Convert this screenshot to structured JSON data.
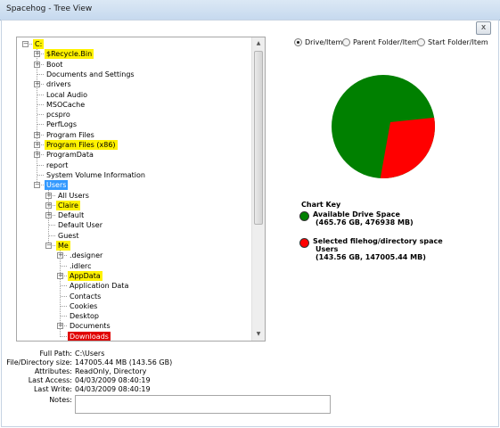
{
  "window": {
    "title": "Spacehog - Tree View",
    "close_glyph": "x"
  },
  "view_options": [
    {
      "label": "Drive/Item",
      "selected": true
    },
    {
      "label": "Parent Folder/Item",
      "selected": false
    },
    {
      "label": "Start Folder/Item",
      "selected": false
    }
  ],
  "tree": [
    {
      "label": "C:",
      "depth": 0,
      "expander": "minus",
      "highlight": "yellow"
    },
    {
      "label": "$Recycle.Bin",
      "depth": 1,
      "expander": "plus",
      "highlight": "yellow"
    },
    {
      "label": "Boot",
      "depth": 1,
      "expander": "plus",
      "highlight": "none"
    },
    {
      "label": "Documents and Settings",
      "depth": 1,
      "expander": "none",
      "highlight": "none"
    },
    {
      "label": "drivers",
      "depth": 1,
      "expander": "plus",
      "highlight": "none"
    },
    {
      "label": "Local Audio",
      "depth": 1,
      "expander": "none",
      "highlight": "none"
    },
    {
      "label": "MSOCache",
      "depth": 1,
      "expander": "none",
      "highlight": "none"
    },
    {
      "label": "pcspro",
      "depth": 1,
      "expander": "none",
      "highlight": "none"
    },
    {
      "label": "PerfLogs",
      "depth": 1,
      "expander": "none",
      "highlight": "none"
    },
    {
      "label": "Program Files",
      "depth": 1,
      "expander": "plus",
      "highlight": "none"
    },
    {
      "label": "Program Files (x86)",
      "depth": 1,
      "expander": "plus",
      "highlight": "yellow"
    },
    {
      "label": "ProgramData",
      "depth": 1,
      "expander": "plus",
      "highlight": "none"
    },
    {
      "label": "report",
      "depth": 1,
      "expander": "none",
      "highlight": "none"
    },
    {
      "label": "System Volume Information",
      "depth": 1,
      "expander": "none",
      "highlight": "none"
    },
    {
      "label": "Users",
      "depth": 1,
      "expander": "minus",
      "highlight": "blue"
    },
    {
      "label": "All Users",
      "depth": 2,
      "expander": "plus",
      "highlight": "none"
    },
    {
      "label": "Claire",
      "depth": 2,
      "expander": "plus",
      "highlight": "yellow"
    },
    {
      "label": "Default",
      "depth": 2,
      "expander": "plus",
      "highlight": "none"
    },
    {
      "label": "Default User",
      "depth": 2,
      "expander": "none",
      "highlight": "none"
    },
    {
      "label": "Guest",
      "depth": 2,
      "expander": "none",
      "highlight": "none"
    },
    {
      "label": "Me",
      "depth": 2,
      "expander": "minus",
      "highlight": "yellow"
    },
    {
      "label": ".designer",
      "depth": 3,
      "expander": "plus",
      "highlight": "none"
    },
    {
      "label": ".idlerc",
      "depth": 3,
      "expander": "none",
      "highlight": "none"
    },
    {
      "label": "AppData",
      "depth": 3,
      "expander": "plus",
      "highlight": "yellow"
    },
    {
      "label": "Application Data",
      "depth": 3,
      "expander": "none",
      "highlight": "none"
    },
    {
      "label": "Contacts",
      "depth": 3,
      "expander": "none",
      "highlight": "none"
    },
    {
      "label": "Cookies",
      "depth": 3,
      "expander": "none",
      "highlight": "none"
    },
    {
      "label": "Desktop",
      "depth": 3,
      "expander": "none",
      "highlight": "none"
    },
    {
      "label": "Documents",
      "depth": 3,
      "expander": "plus",
      "highlight": "none"
    },
    {
      "label": "Downloads",
      "depth": 3,
      "expander": "none",
      "highlight": "red"
    }
  ],
  "pie": {
    "colors": {
      "available": "#008000",
      "selected": "#ff0000"
    },
    "selected_fraction": 0.3082
  },
  "chart_key": {
    "title": "Chart Key",
    "items": [
      {
        "color": "#008000",
        "line1": "Available Drive Space",
        "line2": "(465.76 GB, 476938 MB)",
        "line3": ""
      },
      {
        "color": "#ff0000",
        "line1": "Selected filehog/directory space",
        "line2": "Users",
        "line3": "(143.56 GB, 147005.44 MB)"
      }
    ]
  },
  "info": {
    "full_path_label": "Full Path:",
    "full_path": "C:\\Users",
    "size_label": "File/Directory size:",
    "size": "147005.44 MB (143.56 GB)",
    "attributes_label": "Attributes:",
    "attributes": "ReadOnly, Directory",
    "last_access_label": "Last Access:",
    "last_access": "04/03/2009 08:40:19",
    "last_write_label": "Last Write:",
    "last_write": "04/03/2009 08:40:19",
    "notes_label": "Notes:",
    "notes_value": ""
  }
}
